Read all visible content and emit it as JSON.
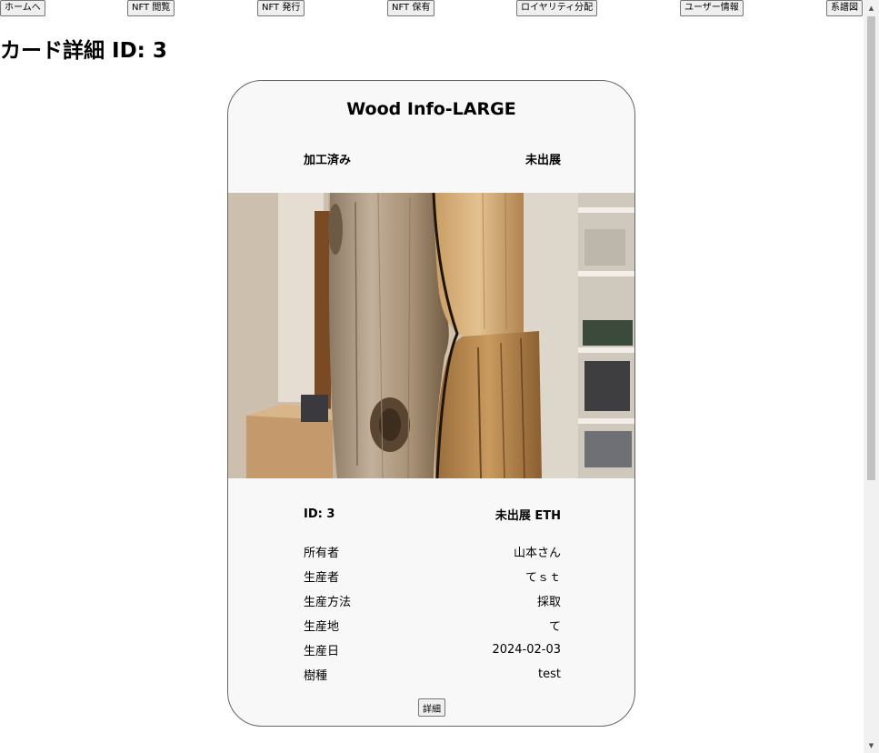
{
  "nav": {
    "home": "ホームへ",
    "browse": "NFT 閲覧",
    "issue": "NFT 発行",
    "owned": "NFT 保有",
    "royalty": "ロイヤリティ分配",
    "user": "ユーザー情報",
    "lineage": "系譜図"
  },
  "page_title": "カード詳細 ID: 3",
  "card": {
    "title": "Wood Info-LARGE",
    "processed_status": "加工済み",
    "listing_status": "未出展",
    "id_label": "ID: 3",
    "price_label": "未出展 ETH",
    "fields": [
      {
        "label": "所有者",
        "value": "山本さん"
      },
      {
        "label": "生産者",
        "value": "てｓｔ"
      },
      {
        "label": "生産方法",
        "value": "採取"
      },
      {
        "label": "生産地",
        "value": "て"
      },
      {
        "label": "生産日",
        "value": "2024-02-03"
      },
      {
        "label": "樹種",
        "value": "test"
      }
    ],
    "detail_button": "詳細",
    "image_icon": "wood-log-photo"
  },
  "colors": {
    "card_background": "#f8f8f8",
    "button_background": "#efefef",
    "scrollbar_thumb": "#c1c1c1"
  }
}
